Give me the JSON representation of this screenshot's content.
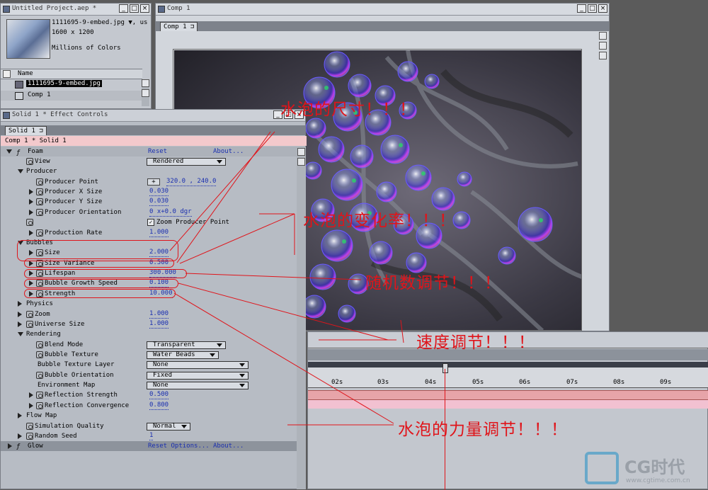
{
  "project": {
    "title": "Untitled Project.aep *",
    "item_name": "1111695-9-embed.jpg ▼, us",
    "dims": "1600 x 1200",
    "colors": "Millions of Colors",
    "col_name": "Name",
    "items": [
      "1111695-9-embed.jpg",
      "Comp 1"
    ]
  },
  "comp": {
    "window_title": "Comp 1",
    "tab_label": "Comp 1"
  },
  "effects": {
    "window_title": "Solid 1 * Effect Controls",
    "tab_label": "Solid 1",
    "breadcrumb": "Comp 1 * Solid 1",
    "foam": {
      "name": "Foam",
      "reset": "Reset",
      "about": "About..."
    },
    "view": {
      "label": "View",
      "value": "Rendered"
    },
    "producer": {
      "label": "Producer",
      "point_label": "Producer Point",
      "point_value": "320.0 , 240.0",
      "x_size_label": "Producer X Size",
      "x_size": "0.030",
      "y_size_label": "Producer Y Size",
      "y_size": "0.030",
      "orient_label": "Producer Orientation",
      "orient_value": "0 x+0.0 dgr",
      "zoom_point": "Zoom Producer Point",
      "rate_label": "Production Rate",
      "rate": "1.000"
    },
    "bubbles": {
      "label": "Bubbles",
      "size_label": "Size",
      "size": "2.000",
      "variance_label": "Size Variance",
      "variance": "0.500",
      "lifespan_label": "Lifespan",
      "lifespan": "300.000",
      "growth_label": "Bubble Growth Speed",
      "growth": "0.100",
      "strength_label": "Strength",
      "strength": "10.000"
    },
    "physics": "Physics",
    "zoom": {
      "label": "Zoom",
      "value": "1.000"
    },
    "universe": {
      "label": "Universe Size",
      "value": "1.000"
    },
    "rendering": {
      "label": "Rendering",
      "blend_label": "Blend Mode",
      "blend": "Transparent",
      "texture_label": "Bubble Texture",
      "texture": "Water Beads",
      "texlayer_label": "Bubble Texture Layer",
      "texlayer": "None",
      "orient_label": "Bubble Orientation",
      "orient": "Fixed",
      "envmap_label": "Environment Map",
      "envmap": "None",
      "refl_label": "Reflection Strength",
      "refl": "0.500",
      "conv_label": "Reflection Convergence",
      "conv": "0.800"
    },
    "flowmap": "Flow Map",
    "simq": {
      "label": "Simulation Quality",
      "value": "Normal"
    },
    "seed": {
      "label": "Random Seed",
      "value": "1"
    },
    "glow": {
      "name": "Glow",
      "reset": "Reset Options...",
      "about": "About..."
    }
  },
  "timeline": {
    "ticks": [
      "02s",
      "03s",
      "04s",
      "05s",
      "06s",
      "07s",
      "08s",
      "09s"
    ]
  },
  "annotations": {
    "size": "水泡的尺寸！！！",
    "variance": "水泡的变化率！！！",
    "random": "随机数调节！！！",
    "speed": "速度调节！！！",
    "strength": "水泡的力量调节！！！"
  },
  "watermark": {
    "brand": "CG时代",
    "url": "www.cgtime.com.cn"
  },
  "colors": {
    "annotation_red": "#e0141a",
    "value_blue": "#1a2fb0",
    "breadcrumb_pink": "#f3c9cc"
  }
}
